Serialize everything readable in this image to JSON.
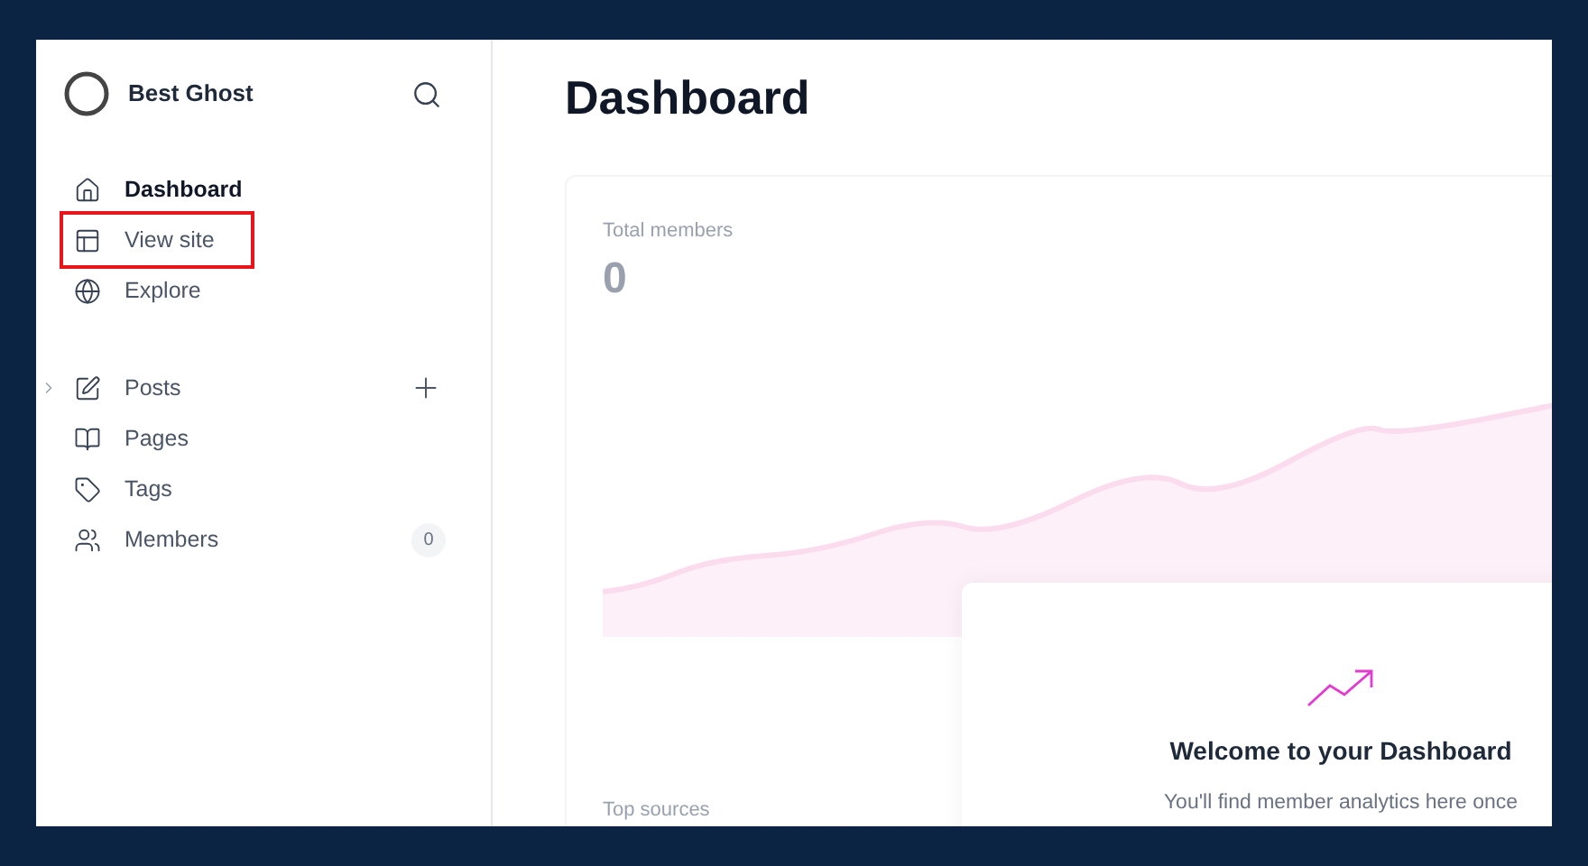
{
  "sidebar": {
    "site_name": "Best Ghost",
    "nav_primary": [
      {
        "label": "Dashboard",
        "selected": true,
        "highlighted": false
      },
      {
        "label": "View site",
        "selected": false,
        "highlighted": true
      },
      {
        "label": "Explore",
        "selected": false,
        "highlighted": false
      }
    ],
    "nav_secondary": [
      {
        "label": "Posts",
        "expandable": true,
        "add": true
      },
      {
        "label": "Pages",
        "expandable": false,
        "add": false
      },
      {
        "label": "Tags",
        "expandable": false,
        "add": false
      },
      {
        "label": "Members",
        "expandable": false,
        "add": false,
        "count": "0"
      }
    ]
  },
  "main": {
    "title": "Dashboard",
    "members_card": {
      "label": "Total members",
      "value": "0"
    },
    "welcome": {
      "title": "Welcome to your Dashboard",
      "text": "You'll find member analytics here once"
    },
    "top_sources": {
      "label": "Top sources"
    }
  }
}
